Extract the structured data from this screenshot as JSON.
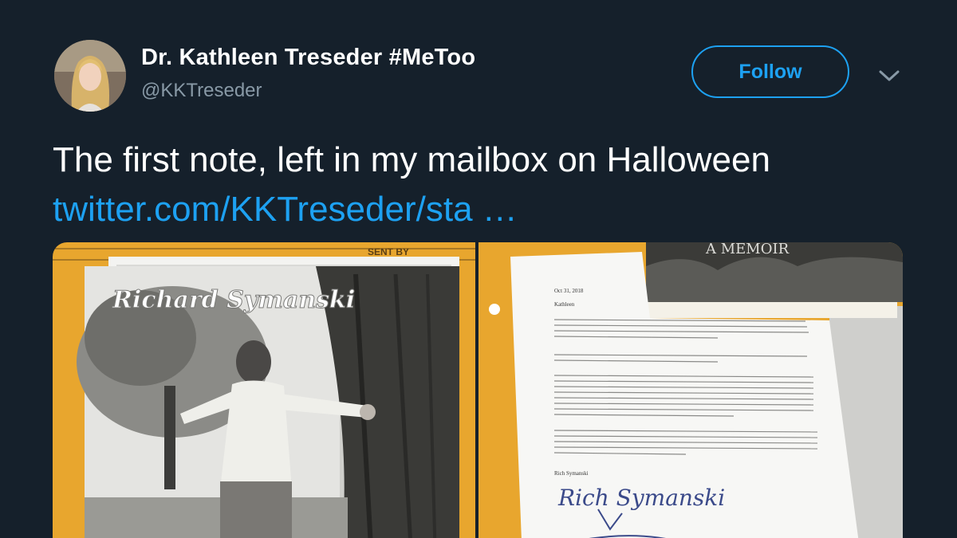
{
  "user": {
    "display_name": "Dr. Kathleen Treseder #MeToo",
    "handle": "@KKTreseder",
    "avatar_icon": "profile-photo"
  },
  "actions": {
    "follow_label": "Follow",
    "menu_icon": "chevron-down-icon"
  },
  "tweet": {
    "text": "The first note, left in my mailbox on Halloween ",
    "link": "twitter.com/KKTreseder/sta …"
  },
  "media": {
    "left_photo": {
      "title": "Richard Symanski",
      "folder_label": "SENT BY"
    },
    "right_photo": {
      "book_text": "A MEMOIR",
      "letter_date": "Oct 31, 2018",
      "letter_salutation": "Kathleen",
      "letter_signoff": "Rich Symanski",
      "letter_signature": "Rich Symanski"
    }
  },
  "colors": {
    "background": "#15202b",
    "accent": "#1da1f2",
    "secondary_text": "#8899a6"
  }
}
